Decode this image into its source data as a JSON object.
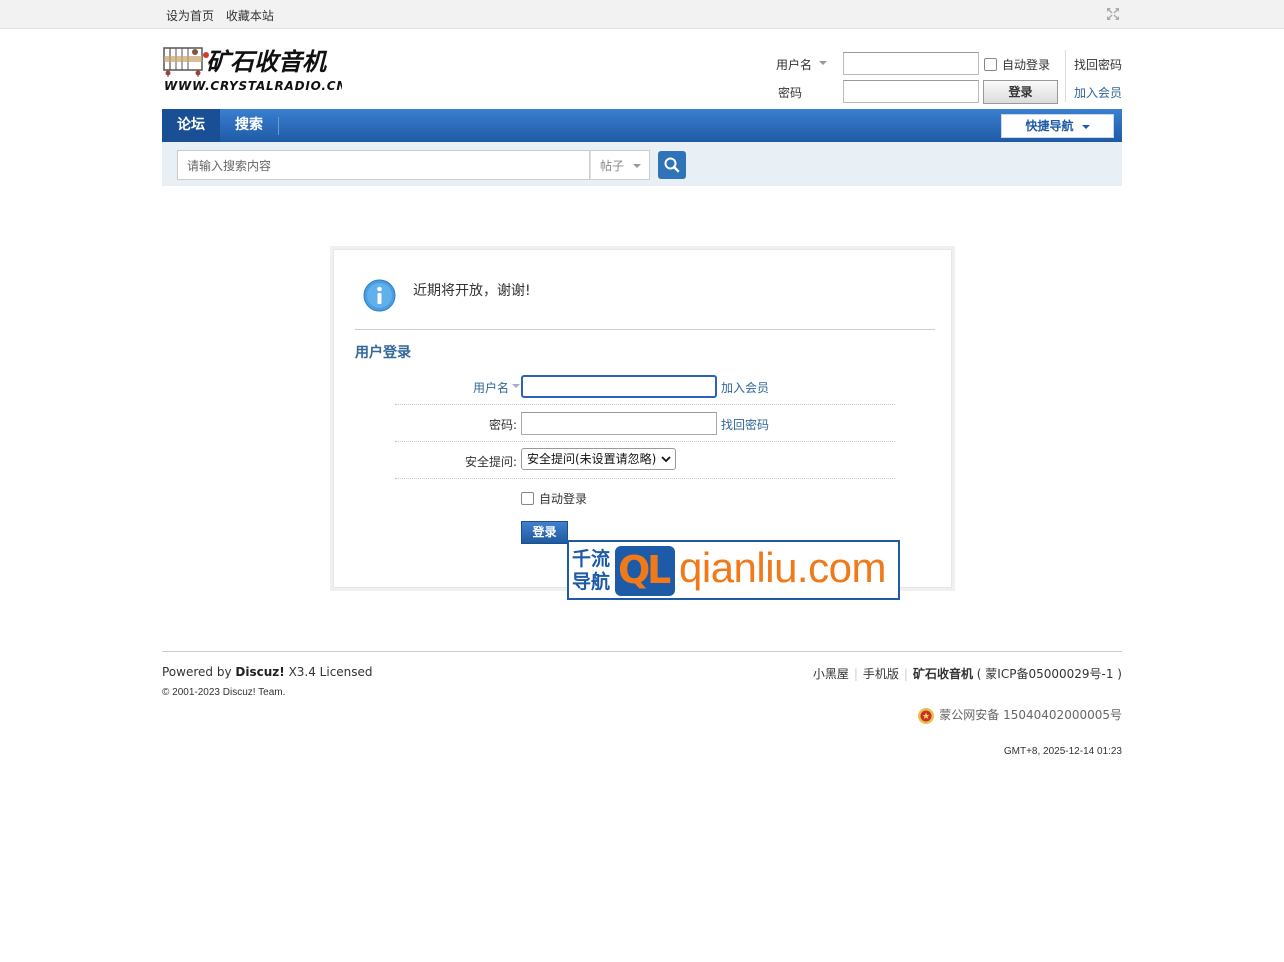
{
  "topbar": {
    "set_home": "设为首页",
    "bookmark": "收藏本站"
  },
  "logo": {
    "site_name": "矿石收音机",
    "site_domain": "WWW.CRYSTALRADIO.CN"
  },
  "header_login": {
    "username_label": "用户名",
    "password_label": "密码",
    "auto_login_label": "自动登录",
    "login_button": "登录",
    "forgot_password": "找回密码",
    "register": "加入会员"
  },
  "nav": {
    "tabs": [
      {
        "label": "论坛",
        "active": true
      },
      {
        "label": "搜索",
        "active": false
      }
    ],
    "quick_nav": "快捷导航"
  },
  "search": {
    "placeholder": "请输入搜索内容",
    "scope": "帖子"
  },
  "message": {
    "text": "近期将开放，谢谢!",
    "login_title": "用户登录",
    "username_label": "用户名",
    "register_link": "加入会员",
    "password_label": "密码:",
    "forgot_link": "找回密码",
    "question_label": "安全提问:",
    "question_value": "安全提问(未设置请忽略)",
    "auto_login_label": "自动登录",
    "login_button": "登录"
  },
  "watermark": {
    "cn_line1": "千流",
    "cn_line2": "导航",
    "ql_q": "Q",
    "ql_l": "L",
    "domain": "qianliu.com"
  },
  "footer": {
    "powered_prefix": "Powered by",
    "powered_brand": "Discuz!",
    "powered_version": "X3.4 Licensed",
    "copyright": "© 2001-2023 Discuz! Team.",
    "links": [
      "小黑屋",
      "手机版"
    ],
    "site_name": "矿石收音机",
    "icp": "( 蒙ICP备05000029号-1 )",
    "police": "蒙公网安备 15040402000005号",
    "time": "GMT+8, 2025-12-14 01:23"
  },
  "colors": {
    "nav_blue": "#1f5aa6",
    "link_blue": "#336699",
    "watermark_orange": "#f07a1a"
  }
}
